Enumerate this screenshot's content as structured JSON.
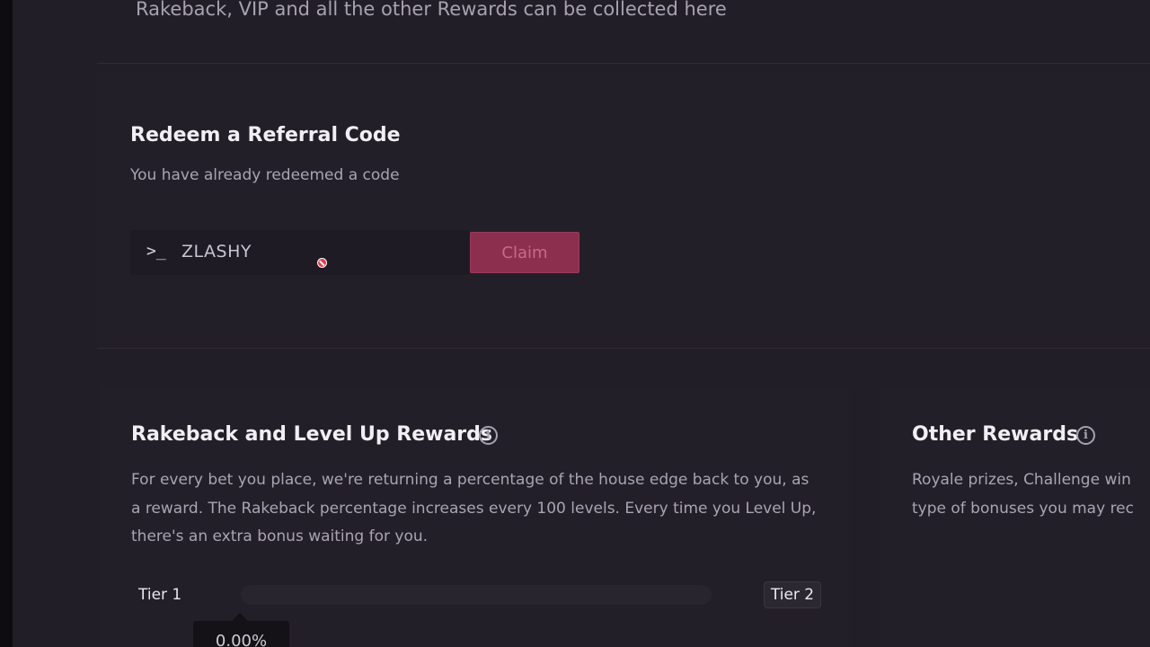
{
  "header": {
    "subtitle": "Rakeback, VIP and all the other Rewards can be collected here"
  },
  "referral": {
    "title": "Redeem a Referral Code",
    "status": "You have already redeemed a code",
    "prompt_glyph": ">_",
    "code_value": "ZLASHY",
    "claim_label": "Claim"
  },
  "rakeback": {
    "title": "Rakeback and Level Up Rewards",
    "description": "For every bet you place, we're returning a percentage of the house edge back to you, as a reward. The Rakeback percentage increases every 100 levels. Every time you Level Up, there's an extra bonus waiting for you.",
    "tier_start": "Tier 1",
    "tier_end": "Tier 2",
    "progress_text": "0.00%",
    "progress_fraction": 0.0
  },
  "other_rewards": {
    "title": "Other Rewards",
    "description": "Royale prizes, Challenge win type of bonuses you may rec"
  },
  "colors": {
    "accent": "#8c2f4f",
    "background": "#221e27"
  },
  "icons": {
    "terminal": "terminal-prompt-icon",
    "info": "info-icon",
    "cursor": "not-allowed-cursor-icon"
  }
}
